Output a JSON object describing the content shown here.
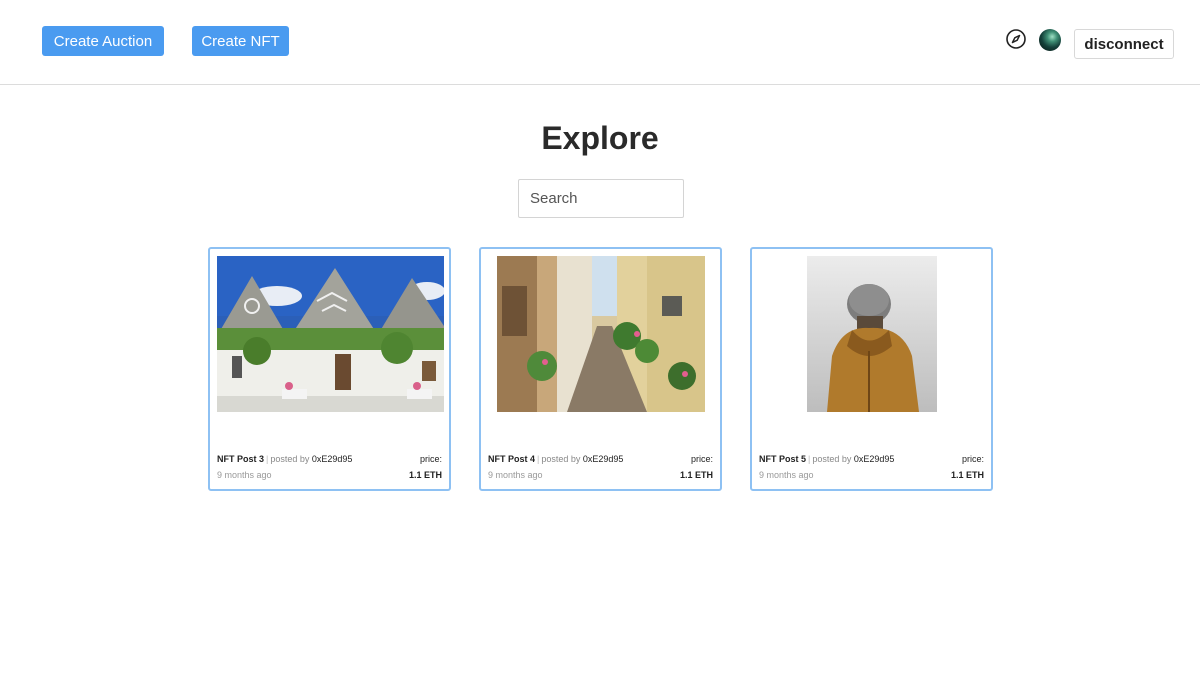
{
  "header": {
    "create_auction_label": "Create Auction",
    "create_nft_label": "Create NFT",
    "disconnect_label": "disconnect",
    "icons": [
      "compass-icon",
      "avatar"
    ]
  },
  "main": {
    "title": "Explore",
    "search": {
      "placeholder": "Search",
      "value": ""
    },
    "cards": [
      {
        "post": "NFT Post 3",
        "posted_by": "posted by",
        "address": "0xE29d95",
        "time": "9 months ago",
        "price_label": "price:",
        "price": "1.1 ETH"
      },
      {
        "post": "NFT Post 4",
        "posted_by": "posted by",
        "address": "0xE29d95",
        "time": "9 months ago",
        "price_label": "price:",
        "price": "1.1 ETH"
      },
      {
        "post": "NFT Post 5",
        "posted_by": "posted by",
        "address": "0xE29d95",
        "time": "9 months ago",
        "price_label": "price:",
        "price": "1.1 ETH"
      }
    ]
  },
  "colors": {
    "accent": "#4a9bf0",
    "card_border": "#8ec1f3"
  }
}
